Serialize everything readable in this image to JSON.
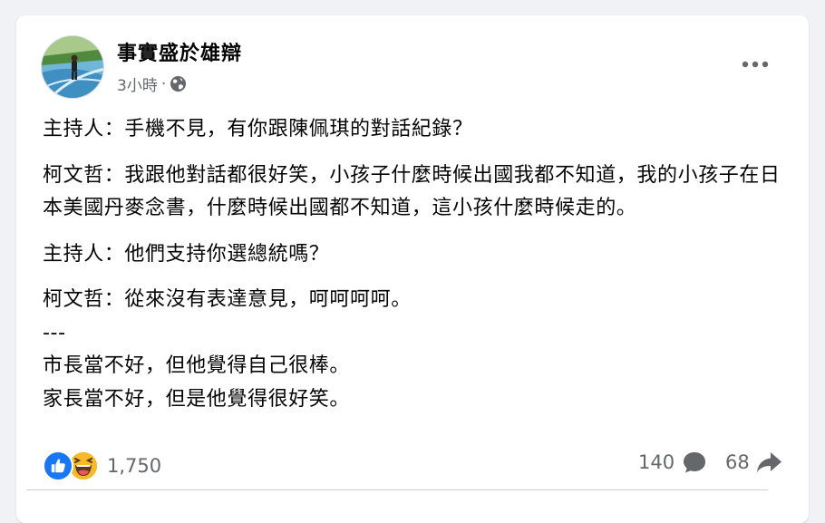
{
  "post": {
    "author": "事實盛於雄辯",
    "time": "3小時",
    "separator": "·",
    "privacy_icon": "globe-icon",
    "more_icon": "more-dots-icon"
  },
  "content": {
    "lines": [
      "主持人：手機不見，有你跟陳佩琪的對話紀錄？",
      "柯文哲：我跟他對話都很好笑，小孩子什麼時候出國我都不知道，我的小孩子在日本美國丹麥念書，什麼時候出國都不知道，這小孩什麼時候走的。",
      "主持人：他們支持你選總統嗎？",
      "柯文哲：從來沒有表達意見，呵呵呵呵。",
      "---",
      "市長當不好，但他覺得自己很棒。",
      "家長當不好，但是他覺得很好笑。"
    ]
  },
  "footer": {
    "reaction_icons": [
      "like-icon",
      "haha-icon"
    ],
    "reaction_count": "1,750",
    "comment_count": "140",
    "share_count": "68"
  },
  "colors": {
    "like": "#1877f2",
    "haha": "#f7b928",
    "secondary_text": "#65676b"
  }
}
